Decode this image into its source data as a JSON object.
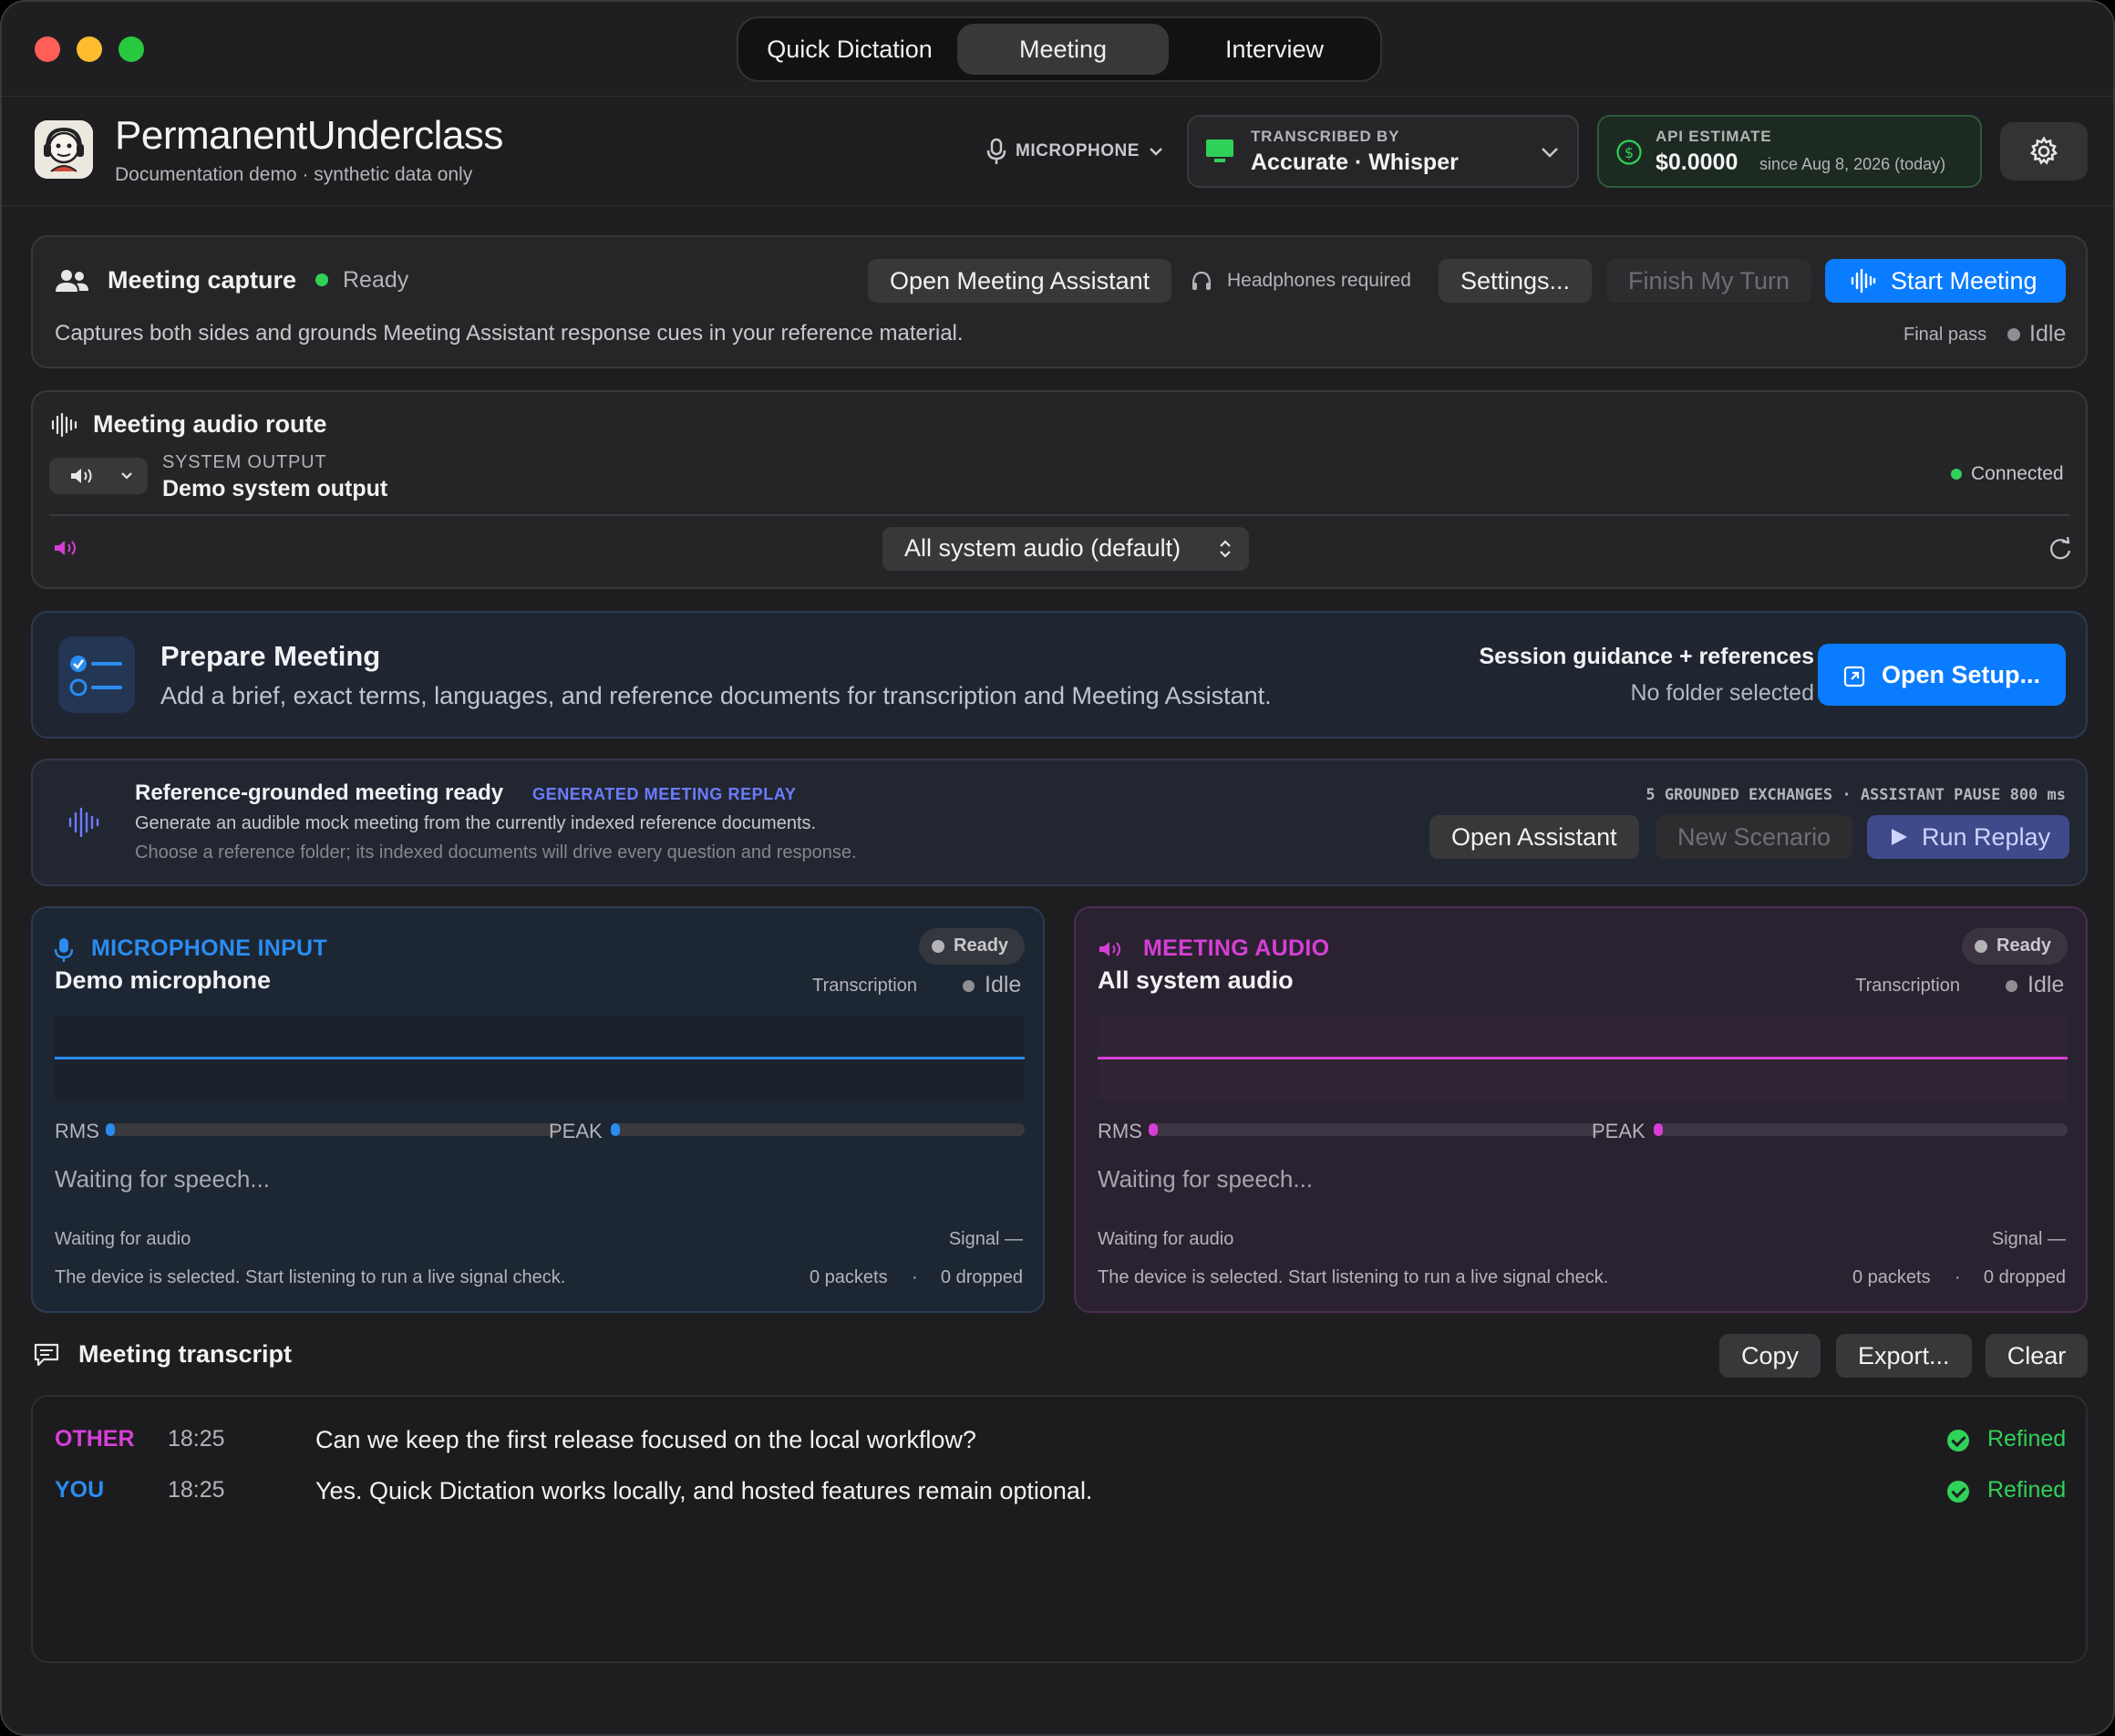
{
  "colors": {
    "accent": "#0a7cff",
    "mic": "#2a8cf0",
    "meeting": "#d63fd6",
    "ready": "#30d158",
    "replay": "#6b7cff"
  },
  "tabs": [
    {
      "label": "Quick Dictation"
    },
    {
      "label": "Meeting"
    },
    {
      "label": "Interview"
    }
  ],
  "header": {
    "title": "PermanentUnderclass",
    "subtitle": "Documentation demo · synthetic data only",
    "mic_label": "MICROPHONE",
    "transcribed_caption": "TRANSCRIBED BY",
    "transcribed_value": "Accurate · Whisper",
    "api_caption": "API ESTIMATE",
    "api_value": "$0.0000",
    "api_since": "since Aug 8, 2026 (today)"
  },
  "capture": {
    "title": "Meeting capture",
    "status": "Ready",
    "open_assistant": "Open Meeting Assistant",
    "headphones": "Headphones required",
    "settings": "Settings...",
    "finish": "Finish My Turn",
    "start": "Start Meeting",
    "description": "Captures both sides and grounds Meeting Assistant response cues in your reference material.",
    "final_pass_label": "Final pass",
    "final_pass_status": "Idle"
  },
  "route": {
    "title": "Meeting audio route",
    "output_caption": "SYSTEM OUTPUT",
    "output_name": "Demo system output",
    "connection": "Connected",
    "selector": "All system audio (default)"
  },
  "prepare": {
    "title": "Prepare Meeting",
    "description": "Add a brief, exact terms, languages, and reference documents for transcription and Meeting Assistant.",
    "guidance": "Session guidance + references",
    "folder": "No folder selected",
    "open_setup": "Open Setup..."
  },
  "replay": {
    "title": "Reference-grounded meeting ready",
    "badge": "GENERATED MEETING REPLAY",
    "line1": "Generate an audible mock meeting from the currently indexed reference documents.",
    "line2": "Choose a reference folder; its indexed documents will drive every question and response.",
    "stats": "5 GROUNDED EXCHANGES · ASSISTANT PAUSE 800 ms",
    "open_assistant": "Open Assistant",
    "new_scenario": "New Scenario",
    "run_replay": "Run Replay"
  },
  "mic_card": {
    "caption": "MICROPHONE INPUT",
    "device": "Demo microphone",
    "ready": "Ready",
    "transcription_label": "Transcription",
    "transcription_status": "Idle",
    "rms_label": "RMS",
    "peak_label": "PEAK",
    "rms_level": 0.01,
    "peak_level": 0.01,
    "waiting": "Waiting for speech...",
    "audio_status": "Waiting for audio",
    "signal": "Signal —",
    "hint": "The device is selected. Start listening to run a live signal check.",
    "packets": "0 packets",
    "sep": "·",
    "dropped": "0 dropped"
  },
  "meeting_card": {
    "caption": "MEETING AUDIO",
    "device": "All system audio",
    "ready": "Ready",
    "transcription_label": "Transcription",
    "transcription_status": "Idle",
    "rms_label": "RMS",
    "peak_label": "PEAK",
    "rms_level": 0.01,
    "peak_level": 0.01,
    "waiting": "Waiting for speech...",
    "audio_status": "Waiting for audio",
    "signal": "Signal —",
    "hint": "The device is selected. Start listening to run a live signal check.",
    "packets": "0 packets",
    "sep": "·",
    "dropped": "0 dropped"
  },
  "transcript": {
    "title": "Meeting transcript",
    "copy": "Copy",
    "export": "Export...",
    "clear": "Clear",
    "rows": [
      {
        "speaker": "OTHER",
        "time": "18:25",
        "text": "Can we keep the first release focused on the local workflow?",
        "status": "Refined"
      },
      {
        "speaker": "YOU",
        "time": "18:25",
        "text": "Yes. Quick Dictation works locally, and hosted features remain optional.",
        "status": "Refined"
      }
    ]
  }
}
